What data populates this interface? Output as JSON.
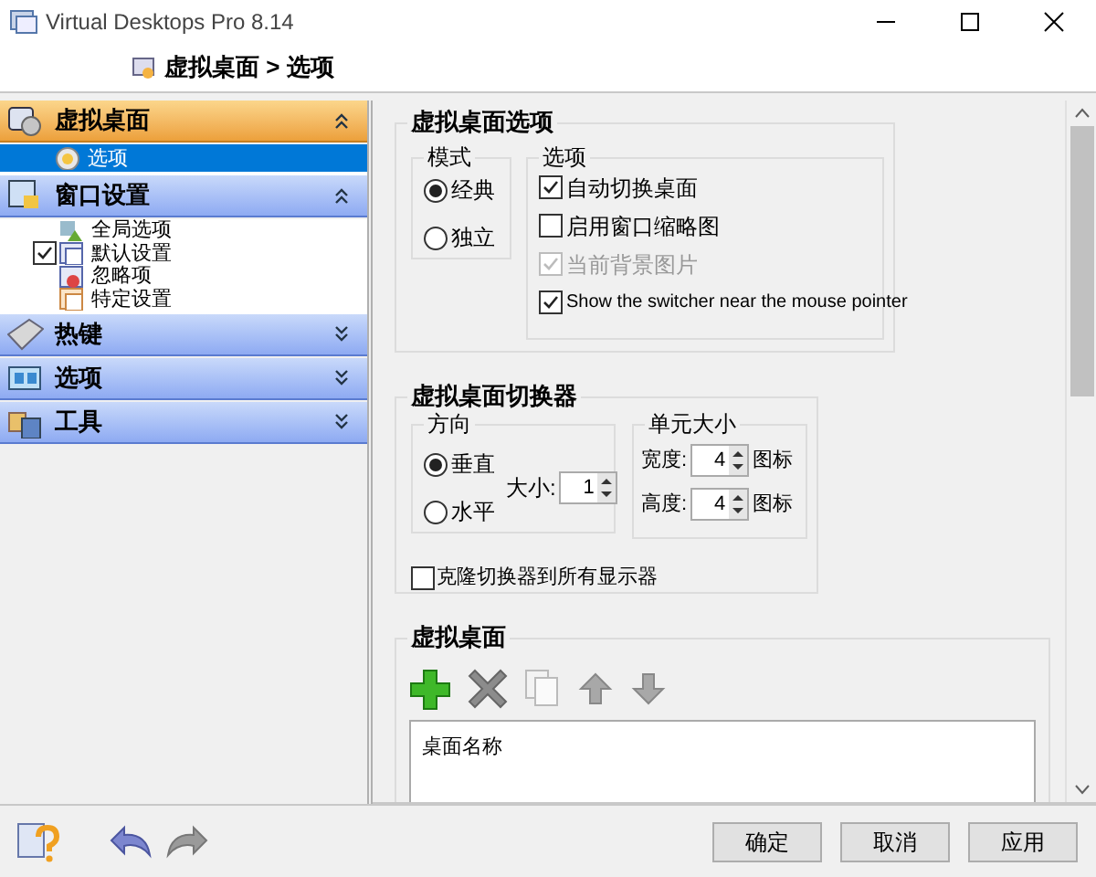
{
  "window": {
    "title": "Virtual Desktops Pro 8.14"
  },
  "breadcrumb": "虚拟桌面 > 选项",
  "sidebar": {
    "sections": [
      {
        "label": "虚拟桌面",
        "selected": true,
        "expanded": true,
        "children": [
          {
            "label": "选项",
            "kind": "plain",
            "selected": true
          }
        ]
      },
      {
        "label": "窗口设置",
        "selected": false,
        "expanded": true,
        "children": [
          {
            "label": "全局选项",
            "kind": "plain",
            "selected": false
          },
          {
            "label": "默认设置",
            "kind": "check",
            "checked": true,
            "selected": false
          },
          {
            "label": "忽略项",
            "kind": "plain",
            "selected": false
          },
          {
            "label": "特定设置",
            "kind": "plain",
            "selected": false
          }
        ]
      },
      {
        "label": "热键",
        "selected": false,
        "expanded": false
      },
      {
        "label": "选项",
        "selected": false,
        "expanded": false
      },
      {
        "label": "工具",
        "selected": false,
        "expanded": false
      }
    ]
  },
  "desktop_options": {
    "title": "虚拟桌面选项",
    "mode": {
      "title": "模式",
      "radios": [
        {
          "label": "经典",
          "selected": true
        },
        {
          "label": "独立",
          "selected": false
        }
      ]
    },
    "options": {
      "title": "选项",
      "checkboxes": [
        {
          "label": "自动切换桌面",
          "checked": true,
          "disabled": false
        },
        {
          "label": "启用窗口缩略图",
          "checked": false,
          "disabled": false
        },
        {
          "label": "当前背景图片",
          "checked": true,
          "disabled": true
        },
        {
          "label": "Show the switcher near the mouse pointer",
          "checked": true,
          "disabled": false
        }
      ]
    }
  },
  "switcher": {
    "title": "虚拟桌面切换器",
    "direction": {
      "title": "方向",
      "radios": [
        {
          "label": "垂直",
          "selected": true
        },
        {
          "label": "水平",
          "selected": false
        }
      ],
      "size_label": "大小:",
      "size_value": "1"
    },
    "unit_size": {
      "title": "单元大小",
      "rows": [
        {
          "label": "宽度:",
          "value": "4",
          "unit": "图标"
        },
        {
          "label": "高度:",
          "value": "4",
          "unit": "图标"
        }
      ]
    },
    "clone": {
      "label": "克隆切换器到所有显示器",
      "checked": false
    }
  },
  "desktops": {
    "title": "虚拟桌面",
    "column": "桌面名称"
  },
  "buttons": [
    "确定",
    "取消",
    "应用"
  ]
}
